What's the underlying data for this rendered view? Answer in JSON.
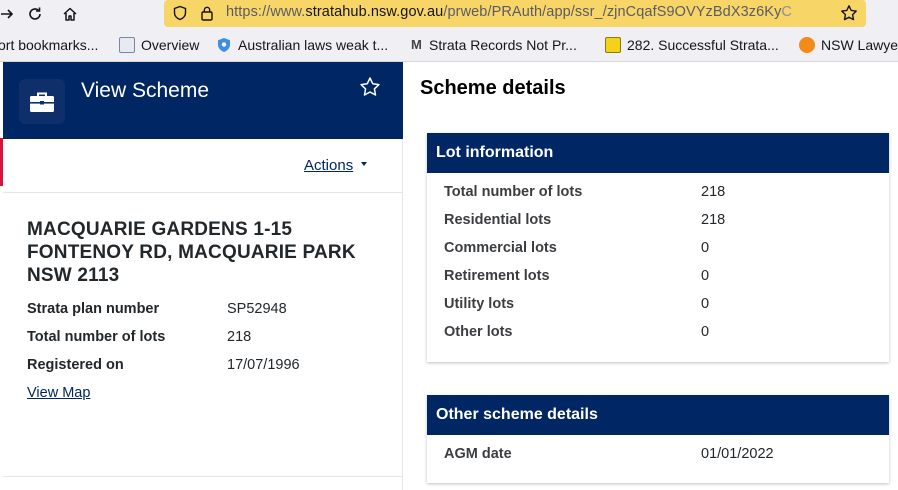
{
  "browser": {
    "url_prefix": "https://www.",
    "url_domain": "stratahub.nsw.gov.au",
    "url_path": "/prweb/PRAuth/app/ssr_/zjnCqafS9OVYzBdX3z6Ky",
    "url_fade": "C",
    "bookmarks": [
      {
        "label": "ort bookmarks...",
        "icon": "bookmarks-folder-icon"
      },
      {
        "label": "Overview",
        "icon": "site-favicon"
      },
      {
        "label": "Australian laws weak t...",
        "icon": "shield-favicon"
      },
      {
        "label": "Strata Records Not Pr...",
        "icon": "gmail-favicon"
      },
      {
        "label": "282. Successful Strata...",
        "icon": "podcast-favicon"
      },
      {
        "label": "NSW Lawye",
        "icon": "lawyer-favicon"
      }
    ]
  },
  "panel": {
    "title": "View Scheme",
    "actions_label": "Actions",
    "address": "MACQUARIE GARDENS 1-15 FONTENOY RD, MACQUARIE PARK NSW 2113",
    "fields": [
      {
        "label": "Strata plan number",
        "value": "SP52948"
      },
      {
        "label": "Total number of lots",
        "value": "218"
      },
      {
        "label": "Registered on",
        "value": "17/07/1996"
      }
    ],
    "view_map_label": "View Map"
  },
  "details": {
    "title": "Scheme details",
    "lot_info": {
      "heading": "Lot information",
      "rows": [
        {
          "label": "Total number of lots",
          "value": "218"
        },
        {
          "label": "Residential lots",
          "value": "218"
        },
        {
          "label": "Commercial lots",
          "value": "0"
        },
        {
          "label": "Retirement lots",
          "value": "0"
        },
        {
          "label": "Utility lots",
          "value": "0"
        },
        {
          "label": "Other lots",
          "value": "0"
        }
      ]
    },
    "other": {
      "heading": "Other scheme details",
      "rows": [
        {
          "label": "AGM date",
          "value": "01/01/2022"
        }
      ]
    }
  },
  "colors": {
    "navy": "#002664",
    "accent_red": "#d7153a",
    "url_highlight": "#f8d567"
  }
}
